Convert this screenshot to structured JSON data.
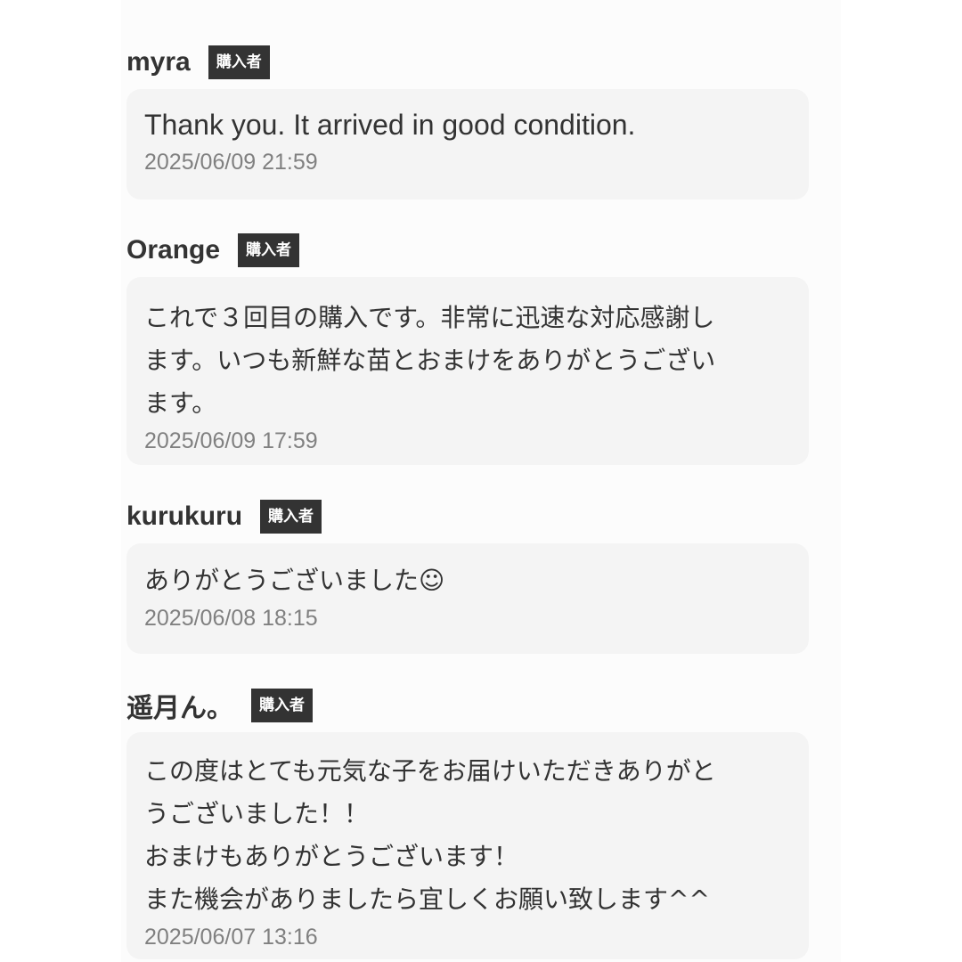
{
  "reviews": [
    {
      "name": "myra",
      "badge": "購入者",
      "comment": "Thank you. It arrived in good condition.",
      "timestamp": "2025/06/09 21:59"
    },
    {
      "name": "Orange",
      "badge": "購入者",
      "comment": "これで３回目の購入です。非常に迅速な対応感謝し\nます。いつも新鮮な苗とおまけをありがとうござい\nます。",
      "timestamp": "2025/06/09 17:59"
    },
    {
      "name": "kurukuru",
      "badge": "購入者",
      "comment": "ありがとうございました☺",
      "timestamp": "2025/06/08 18:15"
    },
    {
      "name": "遥月ん。",
      "badge": "購入者",
      "comment": "この度はとても元気な子をお届けいただきありがと\nうございました！！\nおまけもありがとうございます！\nまた機会がありましたら宜しくお願い致します^^",
      "timestamp": "2025/06/07 13:16"
    }
  ]
}
